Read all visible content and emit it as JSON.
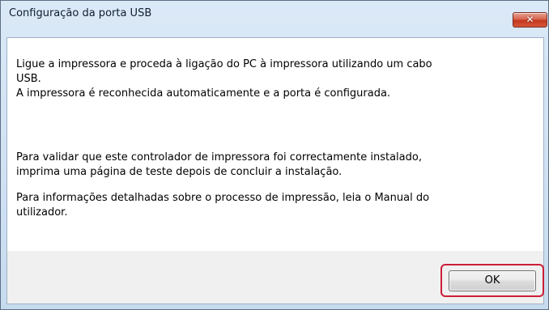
{
  "window": {
    "title": "Configuração da porta USB",
    "close_icon": "close-icon",
    "close_glyph": "✕"
  },
  "message": {
    "paragraph_1_line_1": "Ligue a impressora e proceda à ligação do PC à impressora utilizando um cabo",
    "paragraph_1_line_2": "USB.",
    "paragraph_1_line_3": "A impressora é reconhecida automaticamente e a porta é configurada.",
    "paragraph_2_line_1": "Para validar que este controlador de impressora foi correctamente instalado,",
    "paragraph_2_line_2": "imprima uma página de teste depois de concluir a instalação.",
    "paragraph_3_line_1": "Para informações detalhadas sobre o processo de impressão, leia o Manual do",
    "paragraph_3_line_2": "utilizador."
  },
  "buttons": {
    "ok_label": "OK"
  },
  "colors": {
    "highlight": "#cc1e38",
    "close_button": "#c2381e"
  }
}
